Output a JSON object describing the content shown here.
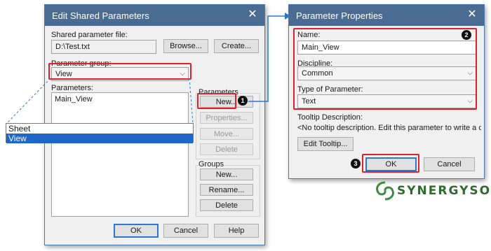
{
  "edit_dialog": {
    "title": "Edit Shared Parameters",
    "file_label": "Shared parameter file:",
    "file_value": "D:\\Test.txt",
    "browse_button": "Browse...",
    "create_button": "Create...",
    "group_label": "Parameter group:",
    "group_value": "View",
    "parameters_label": "Parameters:",
    "parameters_list": [
      "Main_View"
    ],
    "params_box_label": "Parameters",
    "new_button": "New...",
    "properties_button": "Properties...",
    "move_button": "Move...",
    "delete_button": "Delete",
    "groups_box_label": "Groups",
    "groups_new_button": "New...",
    "rename_button": "Rename...",
    "groups_delete_button": "Delete",
    "ok_button": "OK",
    "cancel_button": "Cancel",
    "help_button": "Help"
  },
  "dropdown_list": {
    "options": [
      "Sheet",
      "View"
    ],
    "selected": "View"
  },
  "props_dialog": {
    "title": "Parameter Properties",
    "name_label": "Name:",
    "name_value": "Main_View",
    "discipline_label": "Discipline:",
    "discipline_value": "Common",
    "type_label": "Type of Parameter:",
    "type_value": "Text",
    "tooltip_label": "Tooltip Description:",
    "tooltip_text": "<No tooltip description. Edit this parameter to write a custom",
    "edit_tooltip_button": "Edit Tooltip...",
    "ok_button": "OK",
    "cancel_button": "Cancel"
  },
  "annotations": {
    "badge_1": "1",
    "badge_2": "2",
    "badge_3": "3",
    "highlight_color": "#e0202a",
    "connector_color": "#2b78d3"
  },
  "logo": {
    "text": "SYNERGYSOFT"
  }
}
